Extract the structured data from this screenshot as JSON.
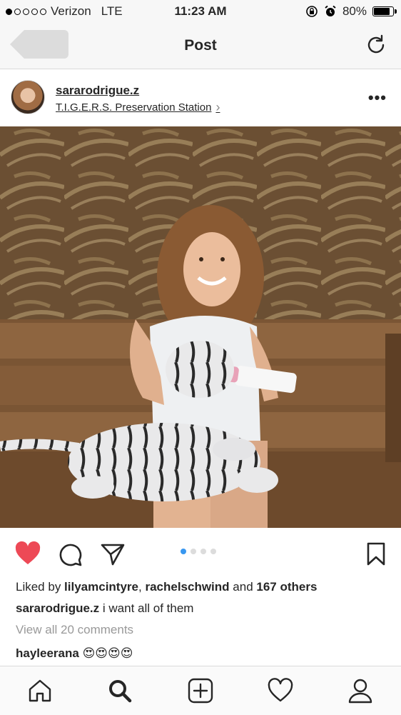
{
  "status_bar": {
    "carrier": "Verizon",
    "network": "LTE",
    "time": "11:23 AM",
    "battery": "80%",
    "battery_level": 0.8,
    "signal_bars_filled": 1,
    "signal_bars_total": 5
  },
  "nav": {
    "title": "Post"
  },
  "post": {
    "username": "sararodrigue.z",
    "location": "T.I.G.E.R.S. Preservation Station",
    "more_label": "•••",
    "carousel_total": 4,
    "carousel_active": 1,
    "liked": true,
    "likes": {
      "prefix": "Liked by ",
      "user1": "lilyamcintyre",
      "sep": ", ",
      "user2": "rachelschwind",
      "and": " and ",
      "others": "167 others"
    },
    "caption": {
      "user": "sararodrigue.z",
      "text": " i want all of them"
    },
    "view_all_comments": "View all 20 comments",
    "comments": [
      {
        "user": "hayleerana",
        "text": " 😍😍😍😍"
      }
    ]
  },
  "colors": {
    "like_red": "#ed4956",
    "pager_active": "#3897f0",
    "muted_text": "#999999"
  },
  "icons": [
    "back-button-icon",
    "refresh-icon",
    "heart-icon",
    "comment-icon",
    "share-icon",
    "bookmark-icon",
    "home-icon",
    "search-icon",
    "add-icon",
    "activity-icon",
    "profile-icon"
  ]
}
